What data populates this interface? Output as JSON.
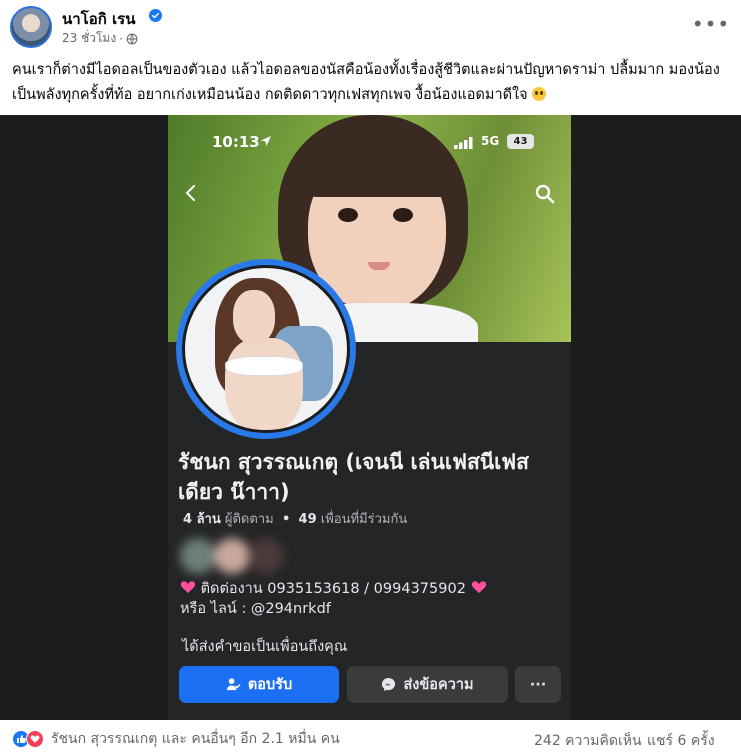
{
  "post": {
    "author": "นาโอกิ เรน",
    "time": "23 ชั่วโมง",
    "separator": "·",
    "caption": "คนเราก็ต่างมีไอดอลเป็นของตัวเอง แล้วไอดอลของนัสคือน้องทั้งเรื่องสู้ชีวิตและผ่านปัญหาดราม่า ปลื้มมาก มองน้องเป็นพลังทุกครั้งที่ท้อ อยากเก่งเหมือนน้อง กดติดดาวทุกเฟสทุกเพจ งื้อน้องแอดมาดีใจ"
  },
  "screenshot": {
    "status_time": "10:13",
    "network": "5G",
    "battery": "43",
    "profile_name": "รัชนก สุวรรณเกตุ (เจนนี เล่นเฟสนีเฟส เดียว น๊าาา)",
    "followers_count": "4 ล้าน",
    "followers_label": "ผู้ติดตาม",
    "stats_separator": "•",
    "mutual_count": "49",
    "mutual_label": "เพื่อนที่มีร่วมกัน",
    "contact_line": "ติดต่องาน 0935153618 / 0994375902",
    "line_id": "หรือ ไลน์ : @294nrkdf",
    "friend_request_text": "ได้ส่งคำขอเป็นเพื่อนถึงคุณ",
    "accept_label": "ตอบรับ",
    "message_label": "ส่งข้อความ",
    "more_label": "···"
  },
  "footer": {
    "reactions_text": "รัชนก สุวรรณเกตุ และ คนอื่นๆ อีก 2.1 หมื่น คน",
    "comments": "242 ความคิดเห็น",
    "shares": "แชร์ 6 ครั้ง"
  },
  "colors": {
    "brand_blue": "#1877f2",
    "love_red": "#f33e58",
    "dark_bg": "#242527",
    "primary_button": "#1b6ff3"
  },
  "icons": [
    "verified-icon",
    "globe-icon",
    "more-icon",
    "emoji-icon",
    "location-icon",
    "signal-icon",
    "back-icon",
    "search-icon",
    "heart-icon",
    "person-check-icon",
    "messenger-icon",
    "like-icon",
    "love-icon"
  ]
}
